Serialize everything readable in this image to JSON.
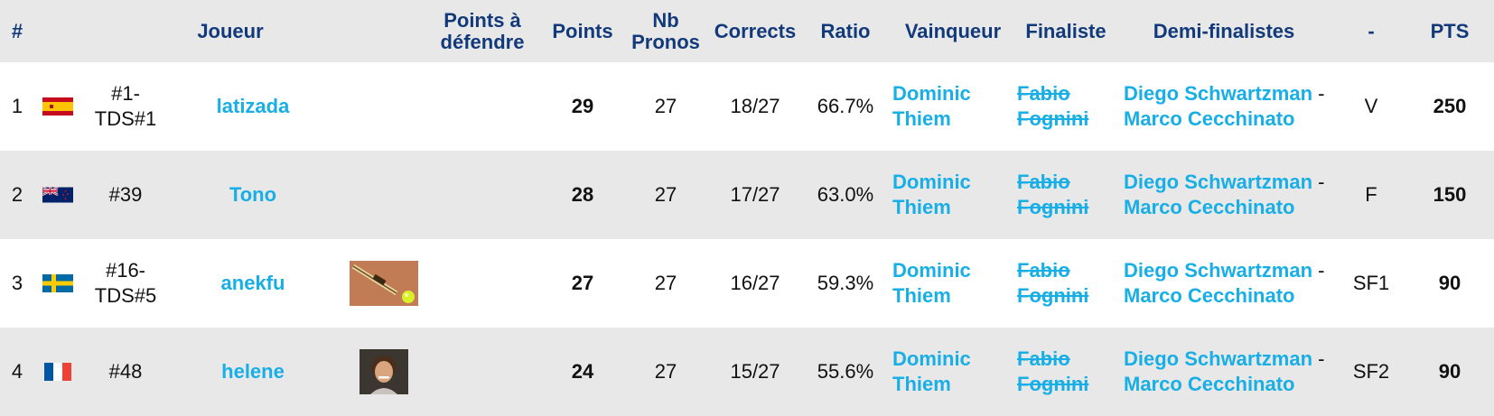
{
  "headers": {
    "num": "#",
    "player": "Joueur",
    "points_defend": "Points à défendre",
    "points": "Points",
    "nb_pronos": "Nb Pronos",
    "corrects": "Corrects",
    "ratio": "Ratio",
    "winner": "Vainqueur",
    "finalist": "Finaliste",
    "semifinalists": "Demi-finalistes",
    "dash": "-",
    "pts": "PTS"
  },
  "rows": [
    {
      "pos": "1",
      "flag": "spain-flag-icon",
      "rank": "#1-TDS#1",
      "player": "latizada",
      "avatar": "",
      "points": "29",
      "nb": "27",
      "corrects": "18/27",
      "ratio": "66.7%",
      "winner": "Dominic Thiem",
      "finalist": "Fabio Fognini",
      "semi1": "Diego Schwartzman",
      "semi_sep": "-",
      "semi2": "Marco Cecchinato",
      "stage": "V",
      "pts": "250"
    },
    {
      "pos": "2",
      "flag": "new-zealand-flag-icon",
      "rank": "#39",
      "player": "Tono",
      "avatar": "",
      "points": "28",
      "nb": "27",
      "corrects": "17/27",
      "ratio": "63.0%",
      "winner": "Dominic Thiem",
      "finalist": "Fabio Fognini",
      "semi1": "Diego Schwartzman",
      "semi_sep": "-",
      "semi2": "Marco Cecchinato",
      "stage": "F",
      "pts": "150"
    },
    {
      "pos": "3",
      "flag": "sweden-flag-icon",
      "rank": "#16-TDS#5",
      "player": "anekfu",
      "avatar": "tennis-racket-ball-avatar",
      "points": "27",
      "nb": "27",
      "corrects": "16/27",
      "ratio": "59.3%",
      "winner": "Dominic Thiem",
      "finalist": "Fabio Fognini",
      "semi1": "Diego Schwartzman",
      "semi_sep": "-",
      "semi2": "Marco Cecchinato",
      "stage": "SF1",
      "pts": "90"
    },
    {
      "pos": "4",
      "flag": "france-flag-icon",
      "rank": "#48",
      "player": "helene",
      "avatar": "player-portrait-avatar",
      "points": "24",
      "nb": "27",
      "corrects": "15/27",
      "ratio": "55.6%",
      "winner": "Dominic Thiem",
      "finalist": "Fabio Fognini",
      "semi1": "Diego Schwartzman",
      "semi_sep": "-",
      "semi2": "Marco Cecchinato",
      "stage": "SF2",
      "pts": "90"
    }
  ],
  "colors": {
    "header_text": "#123a7a",
    "link": "#18aee6",
    "row_alt_bg": "#e8e8e8"
  }
}
